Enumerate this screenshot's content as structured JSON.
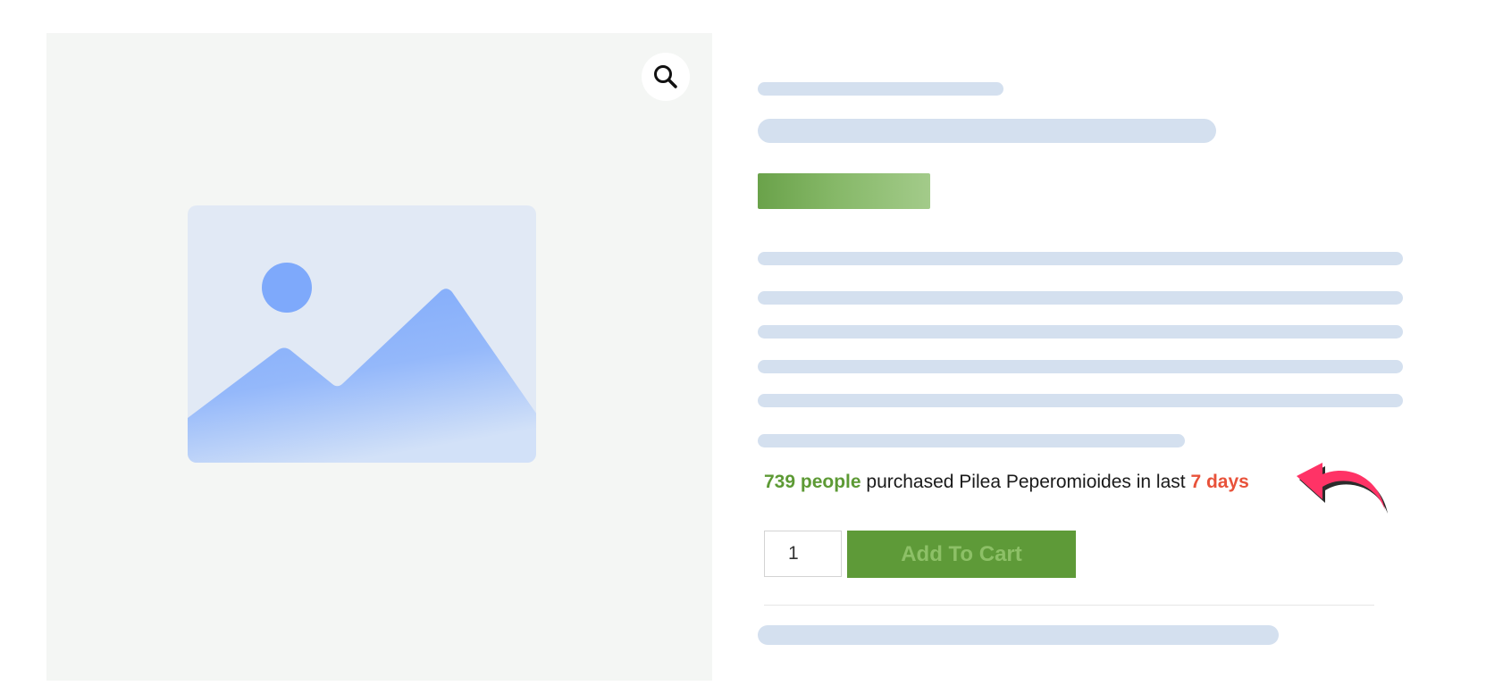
{
  "product": {
    "sales_count": "739 people",
    "sales_text": " purchased Pilea Peperomioides in last ",
    "sales_period": "7 days",
    "quantity": "1",
    "add_to_cart_label": "Add To Cart"
  },
  "icons": {
    "zoom": "magnifier-icon",
    "placeholder": "image-placeholder-icon",
    "pointer": "curved-arrow-icon"
  },
  "colors": {
    "accent_green": "#5e9a38",
    "highlight_red": "#e8523a",
    "skeleton": "#d4e0ef",
    "arrow_pink": "#ff3366"
  }
}
